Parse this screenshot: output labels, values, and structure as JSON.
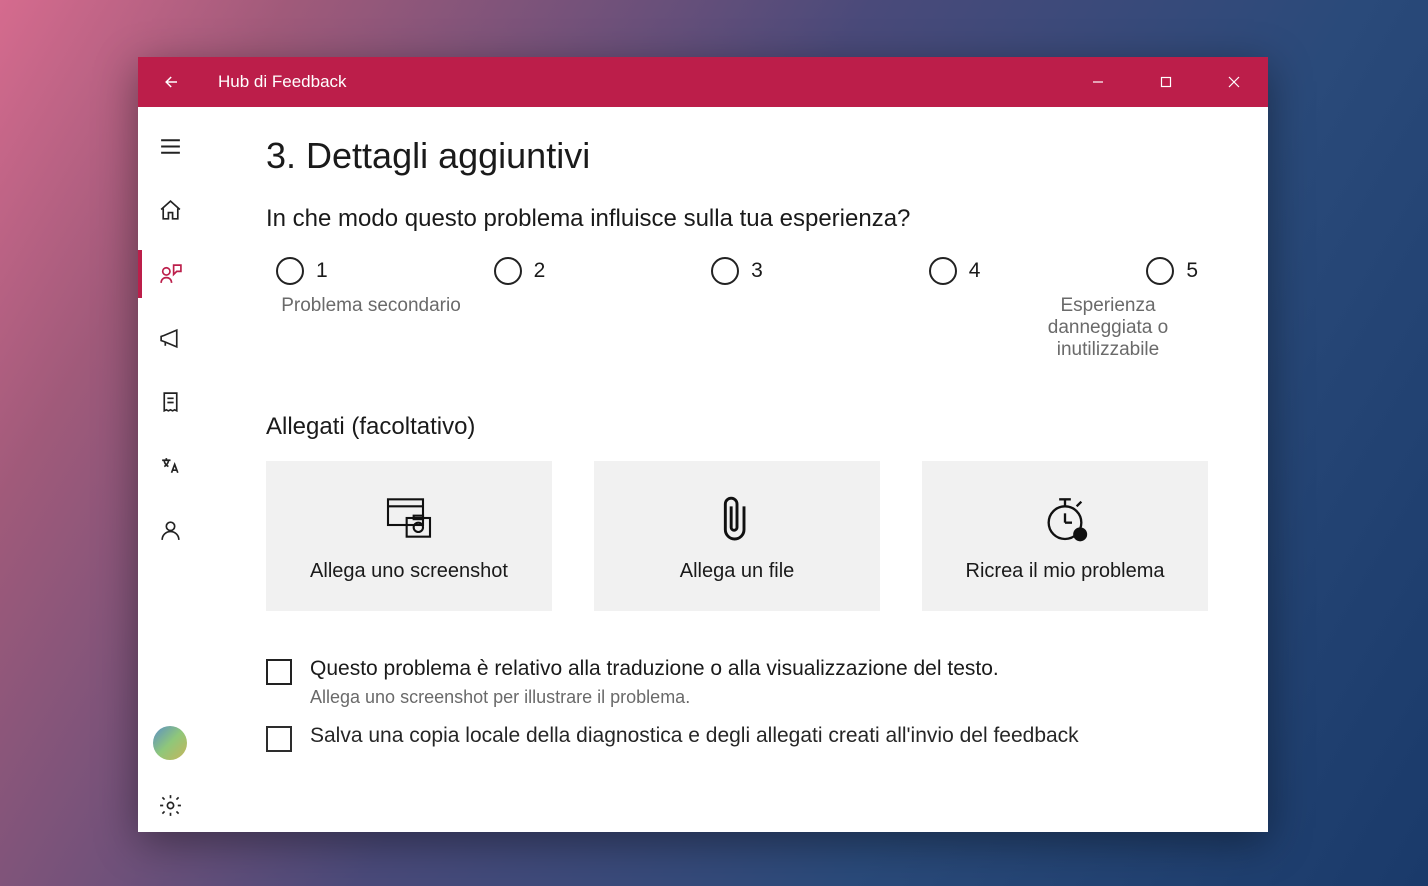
{
  "titlebar": {
    "title": "Hub di Feedback"
  },
  "section": {
    "heading": "3. Dettagli aggiuntivi",
    "question": "In che modo questo problema influisce sulla tua esperienza?",
    "rating": {
      "options": [
        "1",
        "2",
        "3",
        "4",
        "5"
      ],
      "label_low": "Problema secondario",
      "label_high": "Esperienza danneggiata o inutilizzabile"
    },
    "attachments": {
      "heading": "Allegati (facoltativo)",
      "cards": {
        "screenshot": "Allega uno screenshot",
        "file": "Allega un file",
        "recreate": "Ricrea il mio problema"
      }
    },
    "check1": {
      "label": "Questo problema è relativo alla traduzione o alla visualizzazione del testo.",
      "hint": "Allega uno screenshot per illustrare il problema."
    },
    "check2": {
      "label": "Salva una copia locale della diagnostica e degli allegati creati all'invio del feedback"
    }
  }
}
